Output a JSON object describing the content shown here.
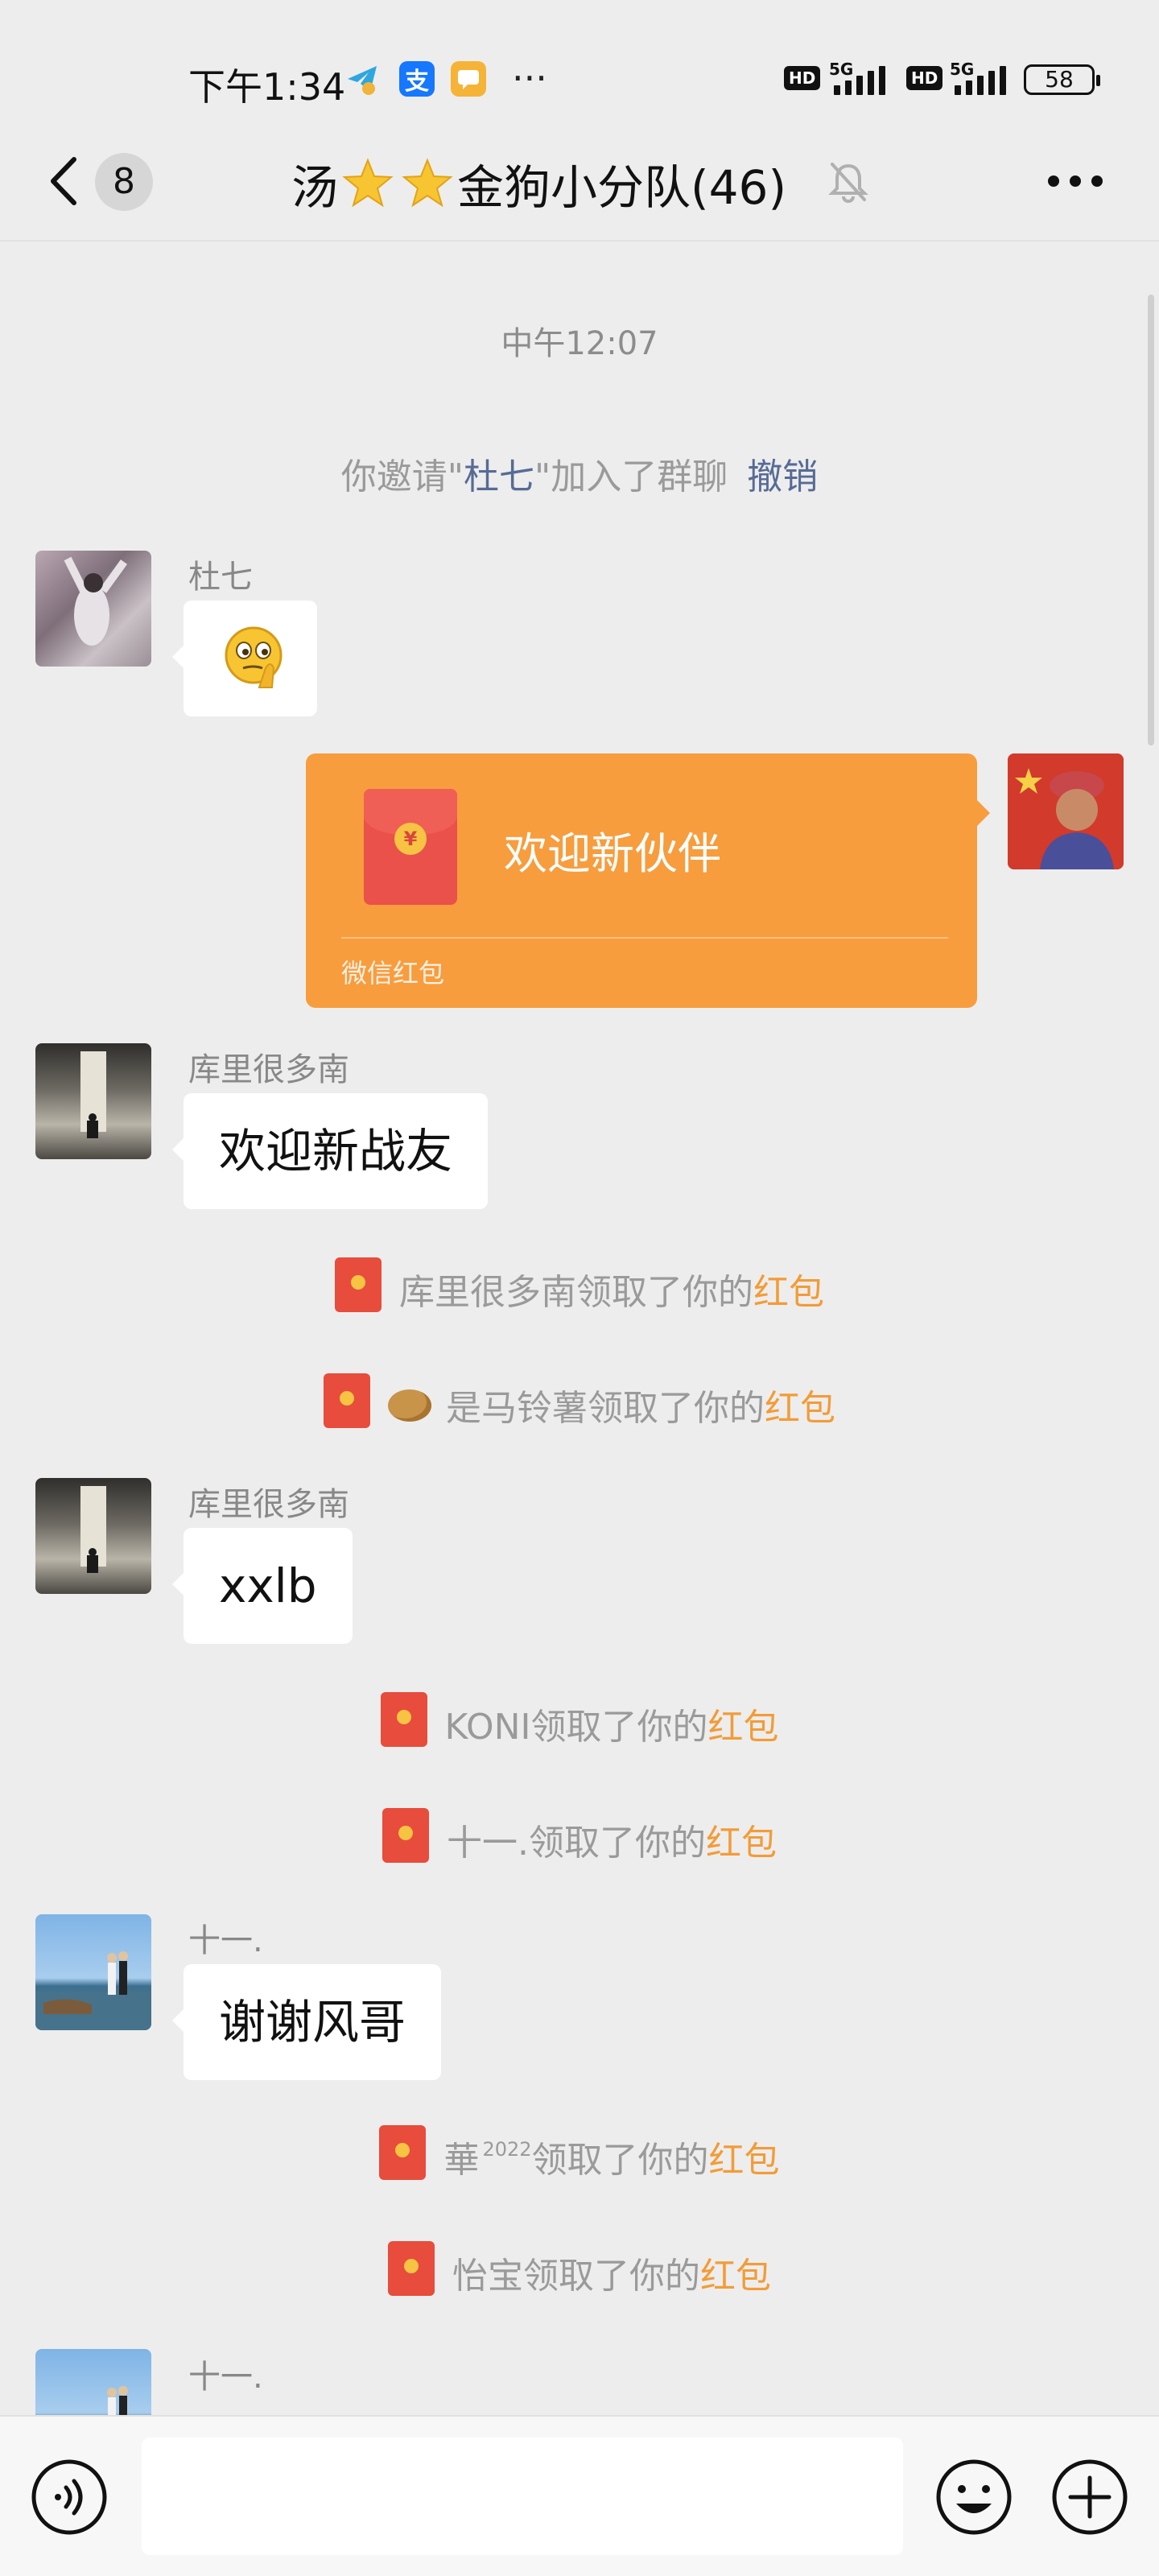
{
  "status_bar": {
    "time": "下午1:34",
    "app_icons": [
      "telegram-icon",
      "alipay-icon",
      "notes-icon"
    ],
    "overflow": "···",
    "network_1": "HD",
    "gen_1": "5G",
    "network_2": "HD",
    "gen_2": "5G",
    "battery": "58"
  },
  "header": {
    "unread_count": "8",
    "title_prefix": "汤",
    "title_suffix": "金狗小分队(46)",
    "title_icons": [
      "star-icon",
      "star-icon"
    ],
    "muted": true
  },
  "chat": {
    "time_divider": "中午12:07",
    "invite": {
      "prefix": "你邀请\"",
      "name": "杜七",
      "suffix": "\"加入了群聊",
      "revoke": "撤销"
    },
    "messages": {
      "m1": {
        "sender": "杜七",
        "content": "sticker: thinking-face"
      },
      "redpacket": {
        "title": "欢迎新伙伴",
        "caption": "微信红包"
      },
      "m2": {
        "sender": "库里很多南",
        "text": "欢迎新战友"
      },
      "m3": {
        "sender": "库里很多南",
        "text": "xxlb"
      },
      "m4": {
        "sender": "十一.",
        "text": "谢谢风哥"
      },
      "m5": {
        "sender": "十一."
      }
    },
    "claims": {
      "c1": {
        "name": "库里很多南",
        "mid": "领取了你的",
        "link": "红包"
      },
      "c2": {
        "name": "是马铃薯",
        "mid": "领取了你的",
        "link": "红包"
      },
      "c3": {
        "name": "KONI",
        "mid": "领取了你的",
        "link": "红包"
      },
      "c4": {
        "name": "十一.",
        "mid": "领取了你的",
        "link": "红包"
      },
      "c5": {
        "name": "華",
        "sup": "2022",
        "mid": "领取了你的",
        "link": "红包"
      },
      "c6": {
        "name": "怡宝",
        "mid": "领取了你的",
        "link": "红包"
      }
    }
  },
  "input_bar": {
    "icons": [
      "voice-icon",
      "emoji-icon",
      "plus-icon"
    ]
  },
  "colors": {
    "background": "#ededed",
    "link_blue": "#576b95",
    "redpacket_orange": "#f79d3e",
    "claim_orange": "#f29c38",
    "bubble_white": "#ffffff"
  }
}
